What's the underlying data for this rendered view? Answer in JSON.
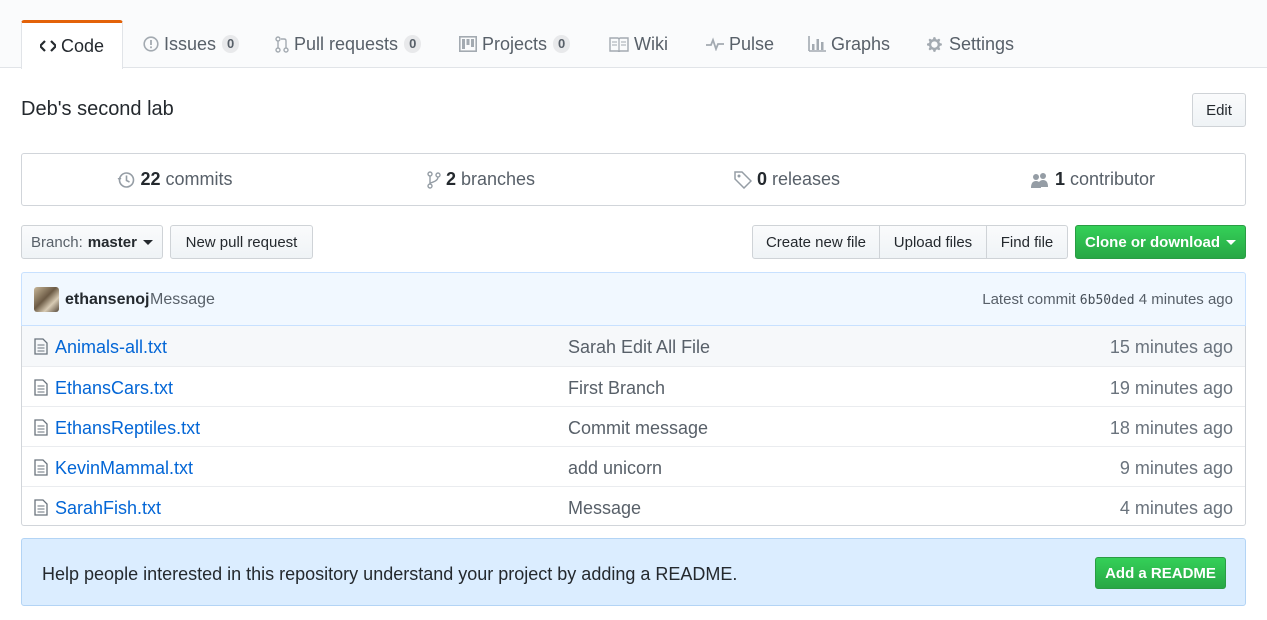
{
  "tabs": {
    "code": {
      "label": "Code"
    },
    "issues": {
      "label": "Issues",
      "count": "0"
    },
    "pulls": {
      "label": "Pull requests",
      "count": "0"
    },
    "projects": {
      "label": "Projects",
      "count": "0"
    },
    "wiki": {
      "label": "Wiki"
    },
    "pulse": {
      "label": "Pulse"
    },
    "graphs": {
      "label": "Graphs"
    },
    "settings": {
      "label": "Settings"
    }
  },
  "repo": {
    "description": "Deb's second lab",
    "edit_label": "Edit"
  },
  "summary": {
    "commits": {
      "num": "22",
      "label": "commits"
    },
    "branches": {
      "num": "2",
      "label": "branches"
    },
    "releases": {
      "num": "0",
      "label": "releases"
    },
    "contributors": {
      "num": "1",
      "label": "contributor"
    }
  },
  "file_nav": {
    "branch_label": "Branch:",
    "branch_value": "master",
    "new_pr": "New pull request",
    "create_file": "Create new file",
    "upload_files": "Upload files",
    "find_file": "Find file",
    "clone": "Clone or download"
  },
  "latest_commit": {
    "author": "ethansenoj",
    "message": "Message",
    "prefix": "Latest commit",
    "sha": "6b50ded",
    "age": "4 minutes ago"
  },
  "files": [
    {
      "name": "Animals-all.txt",
      "message": "Sarah Edit All File",
      "age": "15 minutes ago"
    },
    {
      "name": "EthansCars.txt",
      "message": "First Branch",
      "age": "19 minutes ago"
    },
    {
      "name": "EthansReptiles.txt",
      "message": "Commit message",
      "age": "18 minutes ago"
    },
    {
      "name": "KevinMammal.txt",
      "message": "add unicorn",
      "age": "9 minutes ago"
    },
    {
      "name": "SarahFish.txt",
      "message": "Message",
      "age": "4 minutes ago"
    }
  ],
  "readme_prompt": {
    "text": "Help people interested in this repository understand your project by adding a README.",
    "button": "Add a README"
  },
  "colors": {
    "link": "#0366d6",
    "accent_tab": "#e36209",
    "primary_button": "#28a745",
    "tease_bg": "#f1f8ff",
    "readme_bg": "#dbedff"
  }
}
